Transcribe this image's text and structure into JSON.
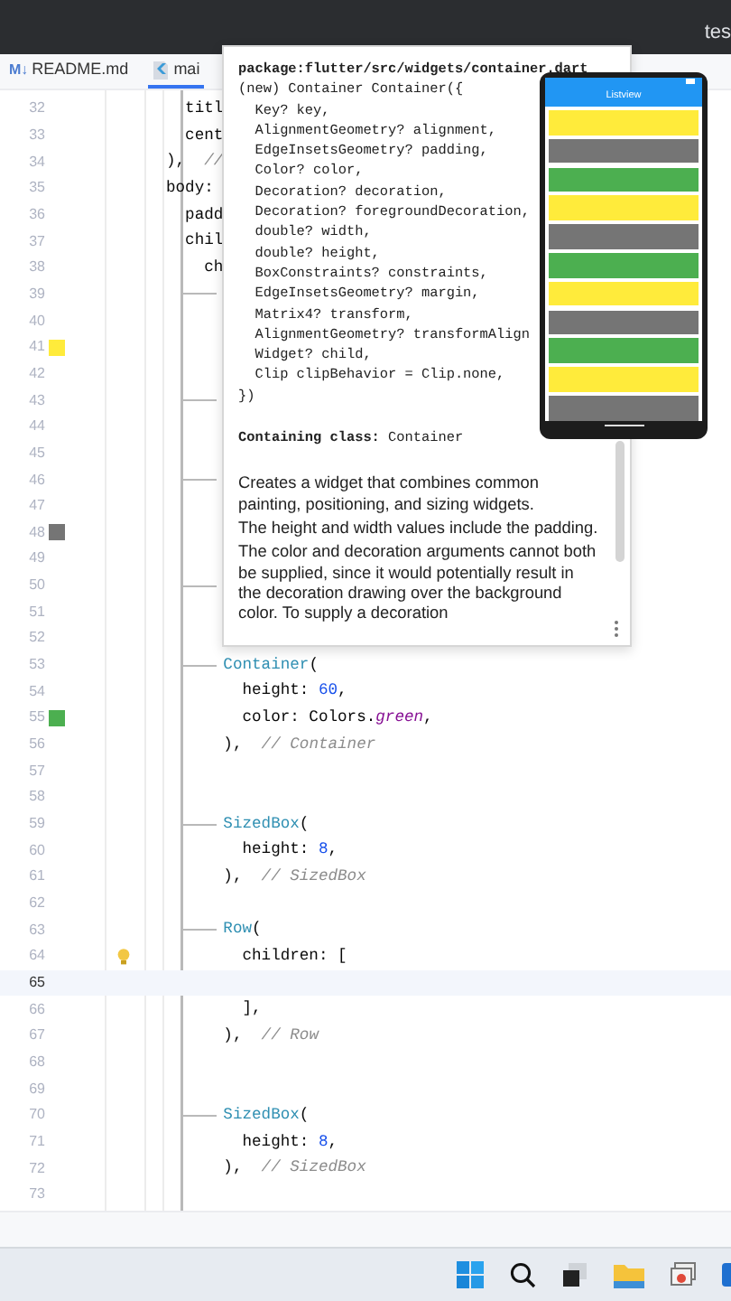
{
  "title_bar": {
    "text": "tes"
  },
  "tabs": [
    {
      "icon": "M↓",
      "label": "README.md",
      "selected": false
    },
    {
      "label": "mai",
      "selected": true
    }
  ],
  "editor": {
    "lines": [
      {
        "number": "32",
        "tokens": [
          {
            "kind": "plain",
            "text": "  titl"
          }
        ],
        "current": false,
        "branch": false,
        "lightbulb": false
      },
      {
        "number": "33",
        "tokens": [
          {
            "kind": "plain",
            "text": "  cent"
          }
        ],
        "current": false,
        "branch": false,
        "lightbulb": false
      },
      {
        "number": "34",
        "tokens": [
          {
            "kind": "plain",
            "text": "),  "
          },
          {
            "kind": "comment",
            "text": "//"
          }
        ],
        "current": false,
        "branch": false,
        "lightbulb": false
      },
      {
        "number": "35",
        "tokens": [
          {
            "kind": "plain",
            "text": "body:"
          }
        ],
        "current": false,
        "branch": false,
        "lightbulb": false
      },
      {
        "number": "36",
        "tokens": [
          {
            "kind": "plain",
            "text": "  padd"
          }
        ],
        "current": false,
        "branch": false,
        "lightbulb": false
      },
      {
        "number": "37",
        "tokens": [
          {
            "kind": "plain",
            "text": "  chil"
          }
        ],
        "current": false,
        "branch": false,
        "lightbulb": false
      },
      {
        "number": "38",
        "tokens": [
          {
            "kind": "plain",
            "text": "    ch"
          }
        ],
        "current": false,
        "branch": false,
        "lightbulb": false
      },
      {
        "number": "39",
        "current": false,
        "branch": true,
        "lightbulb": false
      },
      {
        "number": "40",
        "current": false,
        "branch": false,
        "lightbulb": false
      },
      {
        "number": "41",
        "color": "#ffeb3b",
        "current": false,
        "branch": false,
        "lightbulb": false
      },
      {
        "number": "42",
        "current": false,
        "branch": false,
        "lightbulb": false
      },
      {
        "number": "43",
        "current": false,
        "branch": true,
        "lightbulb": false
      },
      {
        "number": "44",
        "current": false,
        "branch": false,
        "lightbulb": false
      },
      {
        "number": "45",
        "current": false,
        "branch": false,
        "lightbulb": false
      },
      {
        "number": "46",
        "current": false,
        "branch": true,
        "lightbulb": false
      },
      {
        "number": "47",
        "current": false,
        "branch": false,
        "lightbulb": false
      },
      {
        "number": "48",
        "color": "#757575",
        "current": false,
        "branch": false,
        "lightbulb": false
      },
      {
        "number": "49",
        "current": false,
        "branch": false,
        "lightbulb": false
      },
      {
        "number": "50",
        "current": false,
        "branch": true,
        "lightbulb": false
      },
      {
        "number": "51",
        "current": false,
        "branch": false,
        "lightbulb": false
      },
      {
        "number": "52",
        "current": false,
        "branch": false,
        "lightbulb": false
      },
      {
        "number": "53",
        "tokens": [
          {
            "kind": "type",
            "text": "      Container"
          },
          {
            "kind": "plain",
            "text": "("
          }
        ],
        "current": false,
        "branch": true,
        "lightbulb": false
      },
      {
        "number": "54",
        "tokens": [
          {
            "kind": "plain",
            "text": "        height: "
          },
          {
            "kind": "number",
            "text": "60"
          },
          {
            "kind": "plain",
            "text": ","
          }
        ],
        "current": false,
        "branch": false,
        "lightbulb": false
      },
      {
        "number": "55",
        "color": "#4caf50",
        "tokens": [
          {
            "kind": "plain",
            "text": "        color: Colors."
          },
          {
            "kind": "field",
            "text": "green"
          },
          {
            "kind": "plain",
            "text": ","
          }
        ],
        "current": false,
        "branch": false,
        "lightbulb": false
      },
      {
        "number": "56",
        "tokens": [
          {
            "kind": "plain",
            "text": "      ),  "
          },
          {
            "kind": "comment",
            "text": "// Container"
          }
        ],
        "current": false,
        "branch": false,
        "lightbulb": false
      },
      {
        "number": "57",
        "current": false,
        "branch": false,
        "lightbulb": false
      },
      {
        "number": "58",
        "current": false,
        "branch": false,
        "lightbulb": false
      },
      {
        "number": "59",
        "tokens": [
          {
            "kind": "type",
            "text": "      SizedBox"
          },
          {
            "kind": "plain",
            "text": "("
          }
        ],
        "current": false,
        "branch": true,
        "lightbulb": false
      },
      {
        "number": "60",
        "tokens": [
          {
            "kind": "plain",
            "text": "        height: "
          },
          {
            "kind": "number",
            "text": "8"
          },
          {
            "kind": "plain",
            "text": ","
          }
        ],
        "current": false,
        "branch": false,
        "lightbulb": false
      },
      {
        "number": "61",
        "tokens": [
          {
            "kind": "plain",
            "text": "      ),  "
          },
          {
            "kind": "comment",
            "text": "// SizedBox"
          }
        ],
        "current": false,
        "branch": false,
        "lightbulb": false
      },
      {
        "number": "62",
        "current": false,
        "branch": false,
        "lightbulb": false
      },
      {
        "number": "63",
        "tokens": [
          {
            "kind": "type",
            "text": "      Row"
          },
          {
            "kind": "plain",
            "text": "("
          }
        ],
        "current": false,
        "branch": true,
        "lightbulb": false
      },
      {
        "number": "64",
        "tokens": [
          {
            "kind": "plain",
            "text": "        children: ["
          }
        ],
        "current": false,
        "branch": false,
        "lightbulb": true
      },
      {
        "number": "65",
        "current": true,
        "branch": false,
        "lightbulb": false
      },
      {
        "number": "66",
        "tokens": [
          {
            "kind": "plain",
            "text": "        ],"
          }
        ],
        "current": false,
        "branch": false,
        "lightbulb": false
      },
      {
        "number": "67",
        "tokens": [
          {
            "kind": "plain",
            "text": "      ),  "
          },
          {
            "kind": "comment",
            "text": "// Row"
          }
        ],
        "current": false,
        "branch": false,
        "lightbulb": false
      },
      {
        "number": "68",
        "current": false,
        "branch": false,
        "lightbulb": false
      },
      {
        "number": "69",
        "current": false,
        "branch": false,
        "lightbulb": false
      },
      {
        "number": "70",
        "tokens": [
          {
            "kind": "type",
            "text": "      SizedBox"
          },
          {
            "kind": "plain",
            "text": "("
          }
        ],
        "current": false,
        "branch": true,
        "lightbulb": false
      },
      {
        "number": "71",
        "tokens": [
          {
            "kind": "plain",
            "text": "        height: "
          },
          {
            "kind": "number",
            "text": "8"
          },
          {
            "kind": "plain",
            "text": ","
          }
        ],
        "current": false,
        "branch": false,
        "lightbulb": false
      },
      {
        "number": "72",
        "tokens": [
          {
            "kind": "plain",
            "text": "      ),  "
          },
          {
            "kind": "comment",
            "text": "// SizedBox"
          }
        ],
        "current": false,
        "branch": false,
        "lightbulb": false
      },
      {
        "number": "73",
        "current": false,
        "branch": false,
        "lightbulb": false
      }
    ]
  },
  "hover": {
    "package": "package:flutter/src/widgets/container.dart",
    "signature": [
      "(new) Container Container({",
      "  Key? key,",
      "  AlignmentGeometry? alignment,",
      "  EdgeInsetsGeometry? padding,",
      "  Color? color,",
      "  Decoration? decoration,",
      "  Decoration? foregroundDecoration,",
      "  double? width,",
      "  double? height,",
      "  BoxConstraints? constraints,",
      "  EdgeInsetsGeometry? margin,",
      "  Matrix4? transform,",
      "  AlignmentGeometry? transformAlign",
      "  Widget? child,",
      "  Clip clipBehavior = Clip.none,",
      "})"
    ],
    "containing_class": "**Containing class:** Container",
    "paragraphs": [
      "Creates a widget that combines common painting, positioning, and sizing widgets.",
      "The height and width values include the padding.",
      "The color and decoration arguments cannot both be supplied, since it would potentially result in the decoration drawing over the background color. To supply a decoration"
    ]
  },
  "emulator": {
    "app_title": "Listview",
    "items": [
      {
        "color": "#ffeb3b"
      },
      {
        "color": "#757575"
      },
      {
        "color": "#4caf50"
      },
      {
        "color": "#ffeb3b"
      },
      {
        "color": "#757575"
      },
      {
        "color": "#4caf50"
      },
      {
        "color": "#ffeb3b"
      },
      {
        "color": "#757575"
      },
      {
        "color": "#4caf50"
      },
      {
        "color": "#ffeb3b"
      },
      {
        "color": "#757575"
      }
    ]
  }
}
